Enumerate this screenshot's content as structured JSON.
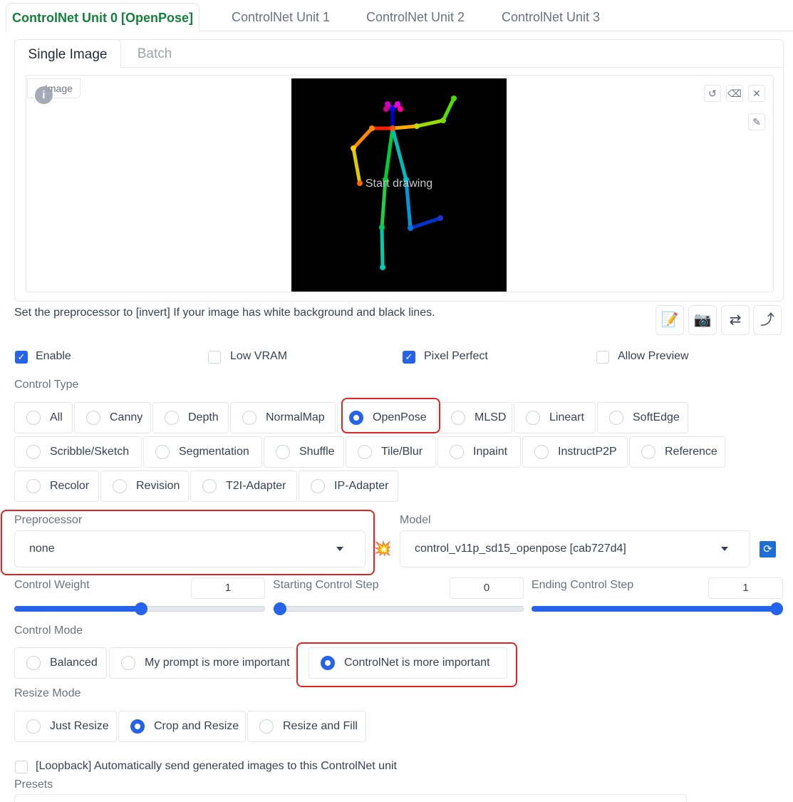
{
  "unit_tabs": [
    "ControlNet Unit 0 [OpenPose]",
    "ControlNet Unit 1",
    "ControlNet Unit 2",
    "ControlNet Unit 3"
  ],
  "image_tabs": [
    "Single Image",
    "Batch"
  ],
  "image_panel": {
    "label": "Image",
    "info": "i",
    "canvas_hint": "Start drawing"
  },
  "hint_text": "Set the preprocessor to [invert] If your image has white background and black lines.",
  "options": {
    "enable": "Enable",
    "low_vram": "Low VRAM",
    "pixel_perfect": "Pixel Perfect",
    "allow_preview": "Allow Preview"
  },
  "control_type": {
    "label": "Control Type",
    "options": [
      "All",
      "Canny",
      "Depth",
      "NormalMap",
      "OpenPose",
      "MLSD",
      "Lineart",
      "SoftEdge",
      "Scribble/Sketch",
      "Segmentation",
      "Shuffle",
      "Tile/Blur",
      "Inpaint",
      "InstructP2P",
      "Reference",
      "Recolor",
      "Revision",
      "T2I-Adapter",
      "IP-Adapter"
    ],
    "selected": "OpenPose"
  },
  "preprocessor": {
    "label": "Preprocessor",
    "value": "none"
  },
  "model": {
    "label": "Model",
    "value": "control_v11p_sd15_openpose [cab727d4]"
  },
  "control_weight": {
    "label": "Control Weight",
    "value": "1",
    "level": 0.5
  },
  "starting_step": {
    "label": "Starting Control Step",
    "value": "0",
    "level": 0.0
  },
  "ending_step": {
    "label": "Ending Control Step",
    "value": "1",
    "level": 1.0
  },
  "control_mode": {
    "label": "Control Mode",
    "options": [
      "Balanced",
      "My prompt is more important",
      "ControlNet is more important"
    ],
    "selected": "ControlNet is more important"
  },
  "resize_mode": {
    "label": "Resize Mode",
    "options": [
      "Just Resize",
      "Crop and Resize",
      "Resize and Fill"
    ],
    "selected": "Crop and Resize"
  },
  "loopback": "[Loopback] Automatically send generated images to this ControlNet unit",
  "presets": {
    "label": "Presets"
  },
  "colors": {
    "accent": "#2563eb",
    "tab_active": "#15803d",
    "highlight": "#dc2626"
  },
  "icons": [
    "undo-icon",
    "eraser-icon",
    "close-icon",
    "brush-icon",
    "edit-icon",
    "camera-icon",
    "swap-icon",
    "send-icon",
    "boom-icon",
    "refresh-icon"
  ]
}
